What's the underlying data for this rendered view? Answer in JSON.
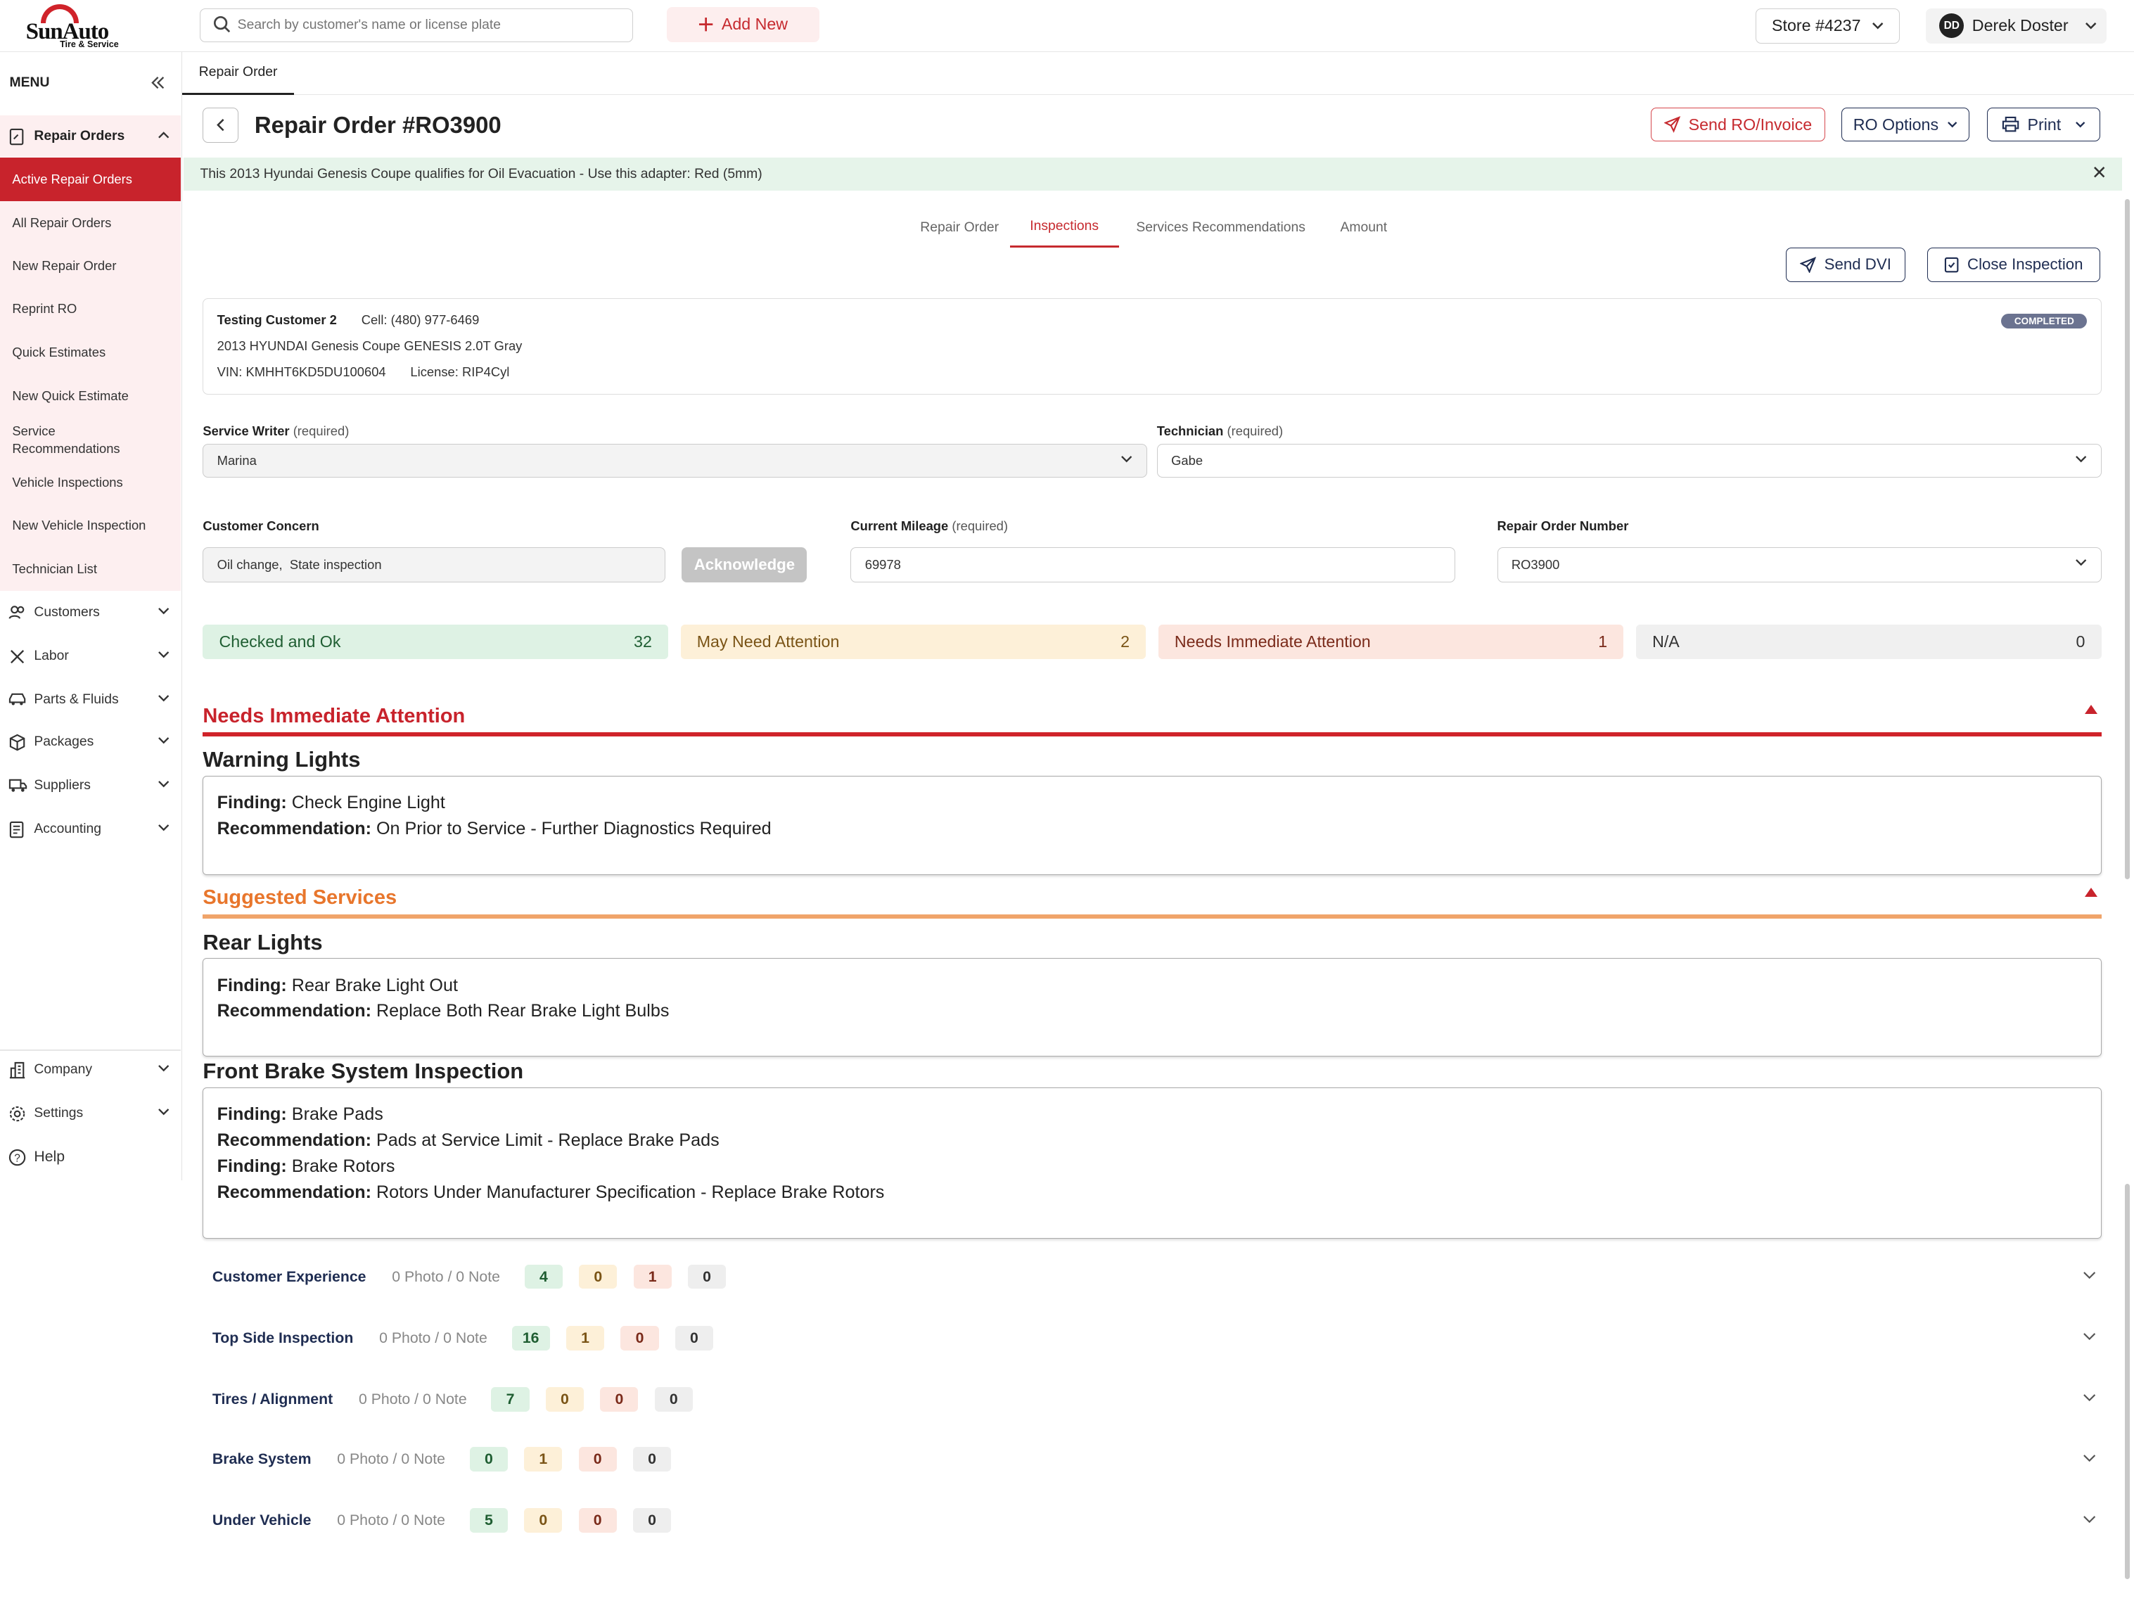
{
  "brand": {
    "name": "SunAuto",
    "tagline": "Tire & Service"
  },
  "header": {
    "search_placeholder": "Search by customer's name or license plate",
    "add_new": "Add New",
    "store": "Store #4237",
    "user_initials": "DD",
    "user_name": "Derek Doster"
  },
  "sidebar": {
    "menu_label": "MENU",
    "repair_orders": "Repair Orders",
    "repair_items": [
      "Active Repair Orders",
      "All Repair Orders",
      "New Repair Order",
      "Reprint RO",
      "Quick Estimates",
      "New Quick Estimate",
      "Service Recommendations",
      "Vehicle Inspections",
      "New Vehicle Inspection",
      "Technician List"
    ],
    "sections": [
      "Customers",
      "Labor",
      "Parts & Fluids",
      "Packages",
      "Suppliers",
      "Accounting"
    ],
    "bottom": [
      "Company",
      "Settings",
      "Help"
    ]
  },
  "page_tab": "Repair Order",
  "page_title": "Repair Order #RO3900",
  "actions": {
    "send": "Send RO/Invoice",
    "options": "RO Options",
    "print": "Print"
  },
  "banner": "This 2013 Hyundai Genesis Coupe qualifies for Oil Evacuation - Use this adapter: Red (5mm)",
  "subtabs": [
    "Repair Order",
    "Inspections",
    "Services Recommendations",
    "Amount"
  ],
  "inspection_actions": {
    "send_dvi": "Send DVI",
    "close": "Close Inspection"
  },
  "customer": {
    "name": "Testing Customer 2",
    "cell": "Cell: (480) 977-6469",
    "vehicle": "2013 HYUNDAI Genesis Coupe GENESIS 2.0T Gray",
    "vin": "VIN: KMHHT6KD5DU100604",
    "license": "License: RIP4Cyl",
    "status": "COMPLETED"
  },
  "form": {
    "service_writer_label": "Service Writer",
    "service_writer": "Marina",
    "technician_label": "Technician",
    "technician": "Gabe",
    "required": "(required)",
    "concern_label": "Customer Concern",
    "concern": "Oil change,  State inspection",
    "acknowledge": "Acknowledge",
    "mileage_label": "Current Mileage",
    "mileage": "69978",
    "ro_number_label": "Repair Order Number",
    "ro_number": "RO3900"
  },
  "stats": [
    {
      "label": "Checked and Ok",
      "count": "32"
    },
    {
      "label": "May Need Attention",
      "count": "2"
    },
    {
      "label": "Needs Immediate Attention",
      "count": "1"
    },
    {
      "label": "N/A",
      "count": "0"
    }
  ],
  "colors": {
    "brand_red": "#c8232c",
    "suggest_orange": "#e8762c",
    "navy": "#1f2d52"
  },
  "labels": {
    "finding": "Finding:",
    "recommendation": "Recommendation:"
  },
  "immediate": {
    "title": "Needs Immediate Attention",
    "group": "Warning Lights",
    "finding": "Check Engine Light",
    "recommendation": "On Prior to Service - Further Diagnostics Required"
  },
  "suggested": {
    "title": "Suggested Services",
    "group1": "Rear Lights",
    "g1_finding": "Rear Brake Light Out",
    "g1_recommendation": "Replace Both Rear Brake Light Bulbs",
    "group2": "Front Brake System Inspection",
    "g2_finding1": "Brake Pads",
    "g2_recommendation1": "Pads at Service Limit - Replace Brake Pads",
    "g2_finding2": "Brake Rotors",
    "g2_recommendation2": "Rotors Under Manufacturer Specification - Replace Brake Rotors"
  },
  "categories": [
    {
      "name": "Customer Experience",
      "media": "0 Photo / 0 Note",
      "ok": "4",
      "may": "0",
      "needs": "1",
      "na": "0"
    },
    {
      "name": "Top Side Inspection",
      "media": "0 Photo / 0 Note",
      "ok": "16",
      "may": "1",
      "needs": "0",
      "na": "0"
    },
    {
      "name": "Tires / Alignment",
      "media": "0 Photo / 0 Note",
      "ok": "7",
      "may": "0",
      "needs": "0",
      "na": "0"
    },
    {
      "name": "Brake System",
      "media": "0 Photo / 0 Note",
      "ok": "0",
      "may": "1",
      "needs": "0",
      "na": "0"
    },
    {
      "name": "Under Vehicle",
      "media": "0 Photo / 0 Note",
      "ok": "5",
      "may": "0",
      "needs": "0",
      "na": "0"
    }
  ]
}
